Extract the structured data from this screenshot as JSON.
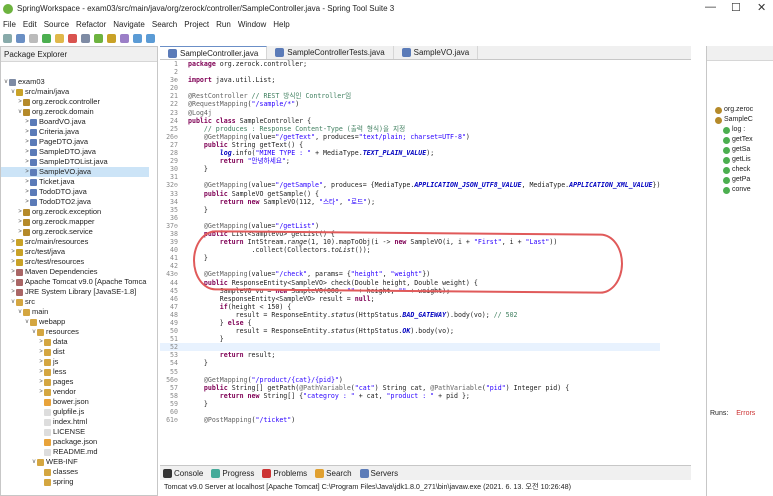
{
  "window": {
    "title": "SpringWorkspace - exam03/src/main/java/org/zerock/controller/SampleController.java - Spring Tool Suite 3"
  },
  "menu": [
    "File",
    "Edit",
    "Source",
    "Refactor",
    "Navigate",
    "Search",
    "Project",
    "Run",
    "Window",
    "Help"
  ],
  "package_explorer": {
    "title": "Package Explorer",
    "nodes": [
      {
        "label": "exam03",
        "depth": 0,
        "twisty": "v",
        "color": "#7e8ba4"
      },
      {
        "label": "src/main/java",
        "depth": 1,
        "twisty": "v",
        "color": "#c9a227"
      },
      {
        "label": "org.zerock.controller",
        "depth": 2,
        "twisty": ">",
        "color": "#b58a2a"
      },
      {
        "label": "org.zerock.domain",
        "depth": 2,
        "twisty": "v",
        "color": "#b58a2a"
      },
      {
        "label": "BoardVO.java",
        "depth": 3,
        "twisty": ">",
        "color": "#5b7bb8"
      },
      {
        "label": "Criteria.java",
        "depth": 3,
        "twisty": ">",
        "color": "#5b7bb8"
      },
      {
        "label": "PageDTO.java",
        "depth": 3,
        "twisty": ">",
        "color": "#5b7bb8"
      },
      {
        "label": "SampleDTO.java",
        "depth": 3,
        "twisty": ">",
        "color": "#5b7bb8"
      },
      {
        "label": "SampleDTOList.java",
        "depth": 3,
        "twisty": ">",
        "color": "#5b7bb8"
      },
      {
        "label": "SampleVO.java",
        "depth": 3,
        "twisty": ">",
        "color": "#5b7bb8",
        "selected": true
      },
      {
        "label": "Ticket.java",
        "depth": 3,
        "twisty": ">",
        "color": "#5b7bb8"
      },
      {
        "label": "TodoDTO.java",
        "depth": 3,
        "twisty": ">",
        "color": "#5b7bb8"
      },
      {
        "label": "TodoDTO2.java",
        "depth": 3,
        "twisty": ">",
        "color": "#5b7bb8"
      },
      {
        "label": "org.zerock.exception",
        "depth": 2,
        "twisty": ">",
        "color": "#b58a2a"
      },
      {
        "label": "org.zerock.mapper",
        "depth": 2,
        "twisty": ">",
        "color": "#b58a2a"
      },
      {
        "label": "org.zerock.service",
        "depth": 2,
        "twisty": ">",
        "color": "#b58a2a"
      },
      {
        "label": "src/main/resources",
        "depth": 1,
        "twisty": ">",
        "color": "#c9a227"
      },
      {
        "label": "src/test/java",
        "depth": 1,
        "twisty": ">",
        "color": "#c9a227"
      },
      {
        "label": "src/test/resources",
        "depth": 1,
        "twisty": ">",
        "color": "#c9a227"
      },
      {
        "label": "Maven Dependencies",
        "depth": 1,
        "twisty": ">",
        "color": "#a66"
      },
      {
        "label": "Apache Tomcat v9.0 [Apache Tomca",
        "depth": 1,
        "twisty": ">",
        "color": "#a66"
      },
      {
        "label": "JRE System Library [JavaSE-1.8]",
        "depth": 1,
        "twisty": ">",
        "color": "#a66"
      },
      {
        "label": "src",
        "depth": 1,
        "twisty": "v",
        "color": "#d4a640"
      },
      {
        "label": "main",
        "depth": 2,
        "twisty": "v",
        "color": "#d4a640"
      },
      {
        "label": "webapp",
        "depth": 3,
        "twisty": "v",
        "color": "#d4a640"
      },
      {
        "label": "resources",
        "depth": 4,
        "twisty": "v",
        "color": "#d4a640"
      },
      {
        "label": "data",
        "depth": 5,
        "twisty": ">",
        "color": "#d4a640"
      },
      {
        "label": "dist",
        "depth": 5,
        "twisty": ">",
        "color": "#d4a640"
      },
      {
        "label": "js",
        "depth": 5,
        "twisty": ">",
        "color": "#d4a640"
      },
      {
        "label": "less",
        "depth": 5,
        "twisty": ">",
        "color": "#d4a640"
      },
      {
        "label": "pages",
        "depth": 5,
        "twisty": ">",
        "color": "#d4a640"
      },
      {
        "label": "vendor",
        "depth": 5,
        "twisty": ">",
        "color": "#d4a640"
      },
      {
        "label": "bower.json",
        "depth": 5,
        "twisty": "",
        "color": "#e8a33a"
      },
      {
        "label": "gulpfile.js",
        "depth": 5,
        "twisty": "",
        "color": "#ddd"
      },
      {
        "label": "index.html",
        "depth": 5,
        "twisty": "",
        "color": "#ddd"
      },
      {
        "label": "LICENSE",
        "depth": 5,
        "twisty": "",
        "color": "#ddd"
      },
      {
        "label": "package.json",
        "depth": 5,
        "twisty": "",
        "color": "#e8a33a"
      },
      {
        "label": "README.md",
        "depth": 5,
        "twisty": "",
        "color": "#ddd"
      },
      {
        "label": "WEB-INF",
        "depth": 4,
        "twisty": "v",
        "color": "#d4a640"
      },
      {
        "label": "classes",
        "depth": 5,
        "twisty": "",
        "color": "#d4a640"
      },
      {
        "label": "spring",
        "depth": 5,
        "twisty": "",
        "color": "#d4a640"
      }
    ]
  },
  "editor_tabs": [
    {
      "label": "SampleController.java",
      "active": true
    },
    {
      "label": "SampleControllerTests.java",
      "active": false
    },
    {
      "label": "SampleVO.java",
      "active": false
    }
  ],
  "code": [
    {
      "n": "1",
      "h": "<span class='kw'>package</span> org.zerock.controller;"
    },
    {
      "n": "2",
      "h": ""
    },
    {
      "n": "3⊕",
      "h": "<span class='kw'>import</span> java.util.List;"
    },
    {
      "n": "20",
      "h": ""
    },
    {
      "n": "21",
      "h": "<span class='an'>@RestController</span> <span class='cm'>// REST 방식인 Controller임</span>"
    },
    {
      "n": "22",
      "h": "<span class='an'>@RequestMapping</span>(<span class='str'>\"/sample/*\"</span>)"
    },
    {
      "n": "23",
      "h": "<span class='an'>@Log4j</span>"
    },
    {
      "n": "24",
      "h": "<span class='kw'>public class</span> SampleController {"
    },
    {
      "n": "25",
      "h": "    <span class='cm'>// produces : Response Content-Type (출력 형식)을 지정</span>"
    },
    {
      "n": "26⊖",
      "h": "    <span class='an'>@GetMapping</span>(value=<span class='str'>\"/getText\"</span>, produces=<span class='str'>\"text/plain; charset=UTF-8\"</span>)"
    },
    {
      "n": "27",
      "h": "    <span class='kw'>public</span> String getText() {"
    },
    {
      "n": "28",
      "h": "        <span class='it'>log</span>.info(<span class='str'>\"MIME TYPE : \"</span> + MediaType.<span class='it'>TEXT_PLAIN_VALUE</span>);"
    },
    {
      "n": "29",
      "h": "        <span class='kw'>return</span> <span class='str'>\"안녕하세요\"</span>;"
    },
    {
      "n": "30",
      "h": "    }"
    },
    {
      "n": "31",
      "h": ""
    },
    {
      "n": "32⊖",
      "h": "    <span class='an'>@GetMapping</span>(value=<span class='str'>\"/getSample\"</span>, produces= {MediaType.<span class='it'>APPLICATION_JSON_UTF8_VALUE</span>, MediaType.<span class='it'>APPLICATION_XML_VALUE</span>})"
    },
    {
      "n": "33",
      "h": "    <span class='kw'>public</span> SampleVO getSample() {"
    },
    {
      "n": "34",
      "h": "        <span class='kw'>return new</span> SampleVO(112, <span class='str'>\"스타\"</span>, <span class='str'>\"로드\"</span>);"
    },
    {
      "n": "35",
      "h": "    }"
    },
    {
      "n": "36",
      "h": ""
    },
    {
      "n": "37⊖",
      "h": "    <span class='an'>@GetMapping</span>(value=<span class='str'>\"/getList\"</span>)"
    },
    {
      "n": "38",
      "h": "    <span class='kw'>public</span> List&lt;SampleVO&gt; getList() {"
    },
    {
      "n": "39",
      "h": "        <span class='kw'>return</span> IntStream.<span style='font-style:italic'>range</span>(1, 10).mapToObj(i -&gt; <span class='kw'>new</span> SampleVO(i, i + <span class='str'>\"First\"</span>, i + <span class='str'>\"Last\"</span>))"
    },
    {
      "n": "40",
      "h": "                .collect(Collectors.<span style='font-style:italic'>toList</span>());"
    },
    {
      "n": "41",
      "h": "    }"
    },
    {
      "n": "42",
      "h": ""
    },
    {
      "n": "43⊖",
      "h": "    <span class='an'>@GetMapping</span>(value=<span class='str'>\"/check\"</span>, params= {<span class='str'>\"height\"</span>, <span class='str'>\"weight\"</span>})"
    },
    {
      "n": "44",
      "h": "    <span class='kw'>public</span> ResponseEntity&lt;SampleVO&gt; check(Double height, Double weight) {"
    },
    {
      "n": "45",
      "h": "        SampleVO vo = <span class='kw'>new</span> SampleVO(000, <span class='str'>\"\"</span> + height, <span class='str'>\"\"</span> + weight);"
    },
    {
      "n": "46",
      "h": "        ResponseEntity&lt;SampleVO&gt; result = <span class='kw'>null</span>;"
    },
    {
      "n": "47",
      "h": "        <span class='kw'>if</span>(height &lt; 150) {"
    },
    {
      "n": "48",
      "h": "            result = ResponseEntity.<span style='font-style:italic'>status</span>(HttpStatus.<span class='it'>BAD_GATEWAY</span>).body(vo); <span class='cm'>// 502</span>"
    },
    {
      "n": "49",
      "h": "        } <span class='kw'>else</span> {"
    },
    {
      "n": "50",
      "h": "            result = ResponseEntity.<span style='font-style:italic'>status</span>(HttpStatus.<span class='it'>OK</span>).body(vo);"
    },
    {
      "n": "51",
      "h": "        }"
    },
    {
      "n": "52",
      "h": "",
      "cur": true
    },
    {
      "n": "53",
      "h": "        <span class='kw'>return</span> result;"
    },
    {
      "n": "54",
      "h": "    }"
    },
    {
      "n": "55",
      "h": ""
    },
    {
      "n": "56⊖",
      "h": "    <span class='an'>@GetMapping</span>(<span class='str'>\"/product/{cat}/{pid}\"</span>)"
    },
    {
      "n": "57",
      "h": "    <span class='kw'>public</span> String[] getPath(<span class='an'>@PathVariable</span>(<span class='str'>\"cat\"</span>) String cat, <span class='an'>@PathVariable</span>(<span class='str'>\"pid\"</span>) Integer pid) {"
    },
    {
      "n": "58",
      "h": "        <span class='kw'>return new</span> String[] {<span class='str'>\"categroy : \"</span> + cat, <span class='str'>\"product : \"</span> + pid };"
    },
    {
      "n": "59",
      "h": "    }"
    },
    {
      "n": "60",
      "h": ""
    },
    {
      "n": "61⊖",
      "h": "    <span class='an'>@PostMapping</span>(<span class='str'>\"/ticket\"</span>)"
    }
  ],
  "bottom": {
    "tabs": [
      "Console",
      "Progress",
      "Problems",
      "Search",
      "Servers"
    ],
    "console_line": "Tomcat v9.0 Server at localhost [Apache Tomcat] C:\\Program Files\\Java\\jdk1.8.0_271\\bin\\javaw.exe  (2021. 6. 13. 오전 10:26:48)"
  },
  "outline": {
    "items": [
      "org.zeroc",
      "SampleC",
      "log :",
      "getTex",
      "getSa",
      "getLis",
      "check",
      "getPa",
      "conve"
    ]
  },
  "right_panel": {
    "runs_label": "Runs:",
    "errors_label": "Errors"
  }
}
